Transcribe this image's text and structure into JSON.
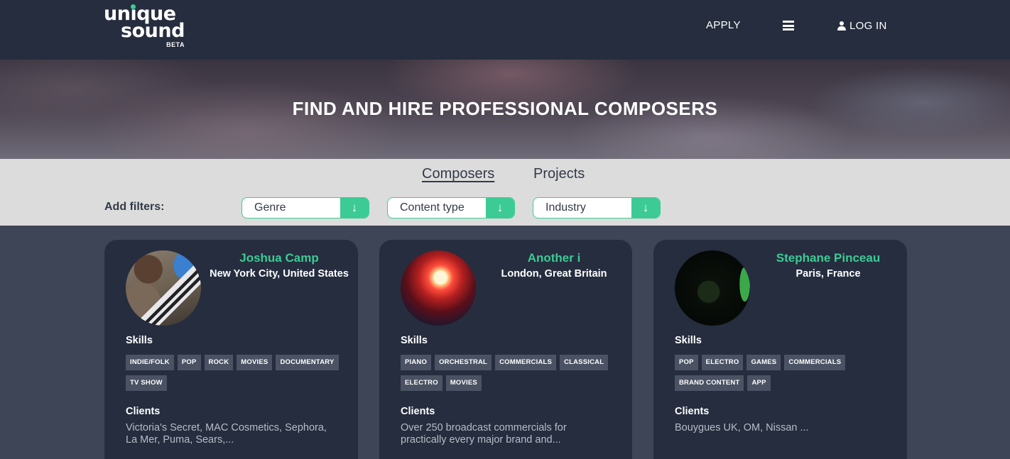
{
  "header": {
    "logo_line1": "unique",
    "logo_line2": "sound",
    "logo_badge": "BETA",
    "nav_apply": "APPLY",
    "nav_login": "LOG IN"
  },
  "hero": {
    "title": "FIND AND HIRE PROFESSIONAL COMPOSERS"
  },
  "tabs": {
    "active": "Composers",
    "inactive": "Projects"
  },
  "filters": {
    "label": "Add filters:",
    "options": [
      "Genre",
      "Content type",
      "Industry"
    ],
    "arrow": "↓"
  },
  "cards": [
    {
      "name": "Joshua Camp",
      "location": "New York City, United States",
      "skills_heading": "Skills",
      "skills": [
        "INDIE/FOLK",
        "POP",
        "ROCK",
        "MOVIES",
        "DOCUMENTARY",
        "TV SHOW"
      ],
      "clients_heading": "Clients",
      "clients": "Victoria's Secret, MAC Cosmetics, Sephora, La Mer, Puma, Sears,..."
    },
    {
      "name": "Another i",
      "location": "London, Great Britain",
      "skills_heading": "Skills",
      "skills": [
        "PIANO",
        "ORCHESTRAL",
        "COMMERCIALS",
        "CLASSICAL",
        "ELECTRO",
        "MOVIES"
      ],
      "clients_heading": "Clients",
      "clients": "Over 250 broadcast commercials for practically every major brand and..."
    },
    {
      "name": "Stephane Pinceau",
      "location": "Paris, France",
      "skills_heading": "Skills",
      "skills": [
        "POP",
        "ELECTRO",
        "GAMES",
        "COMMERCIALS",
        "BRAND CONTENT",
        "APP"
      ],
      "clients_heading": "Clients",
      "clients": "Bouygues UK, OM, Nissan ..."
    }
  ],
  "colors": {
    "accent": "#3ccb95",
    "header_bg": "#252d3e",
    "page_bg": "#3d4556",
    "filter_bg": "#dcdcdc"
  }
}
